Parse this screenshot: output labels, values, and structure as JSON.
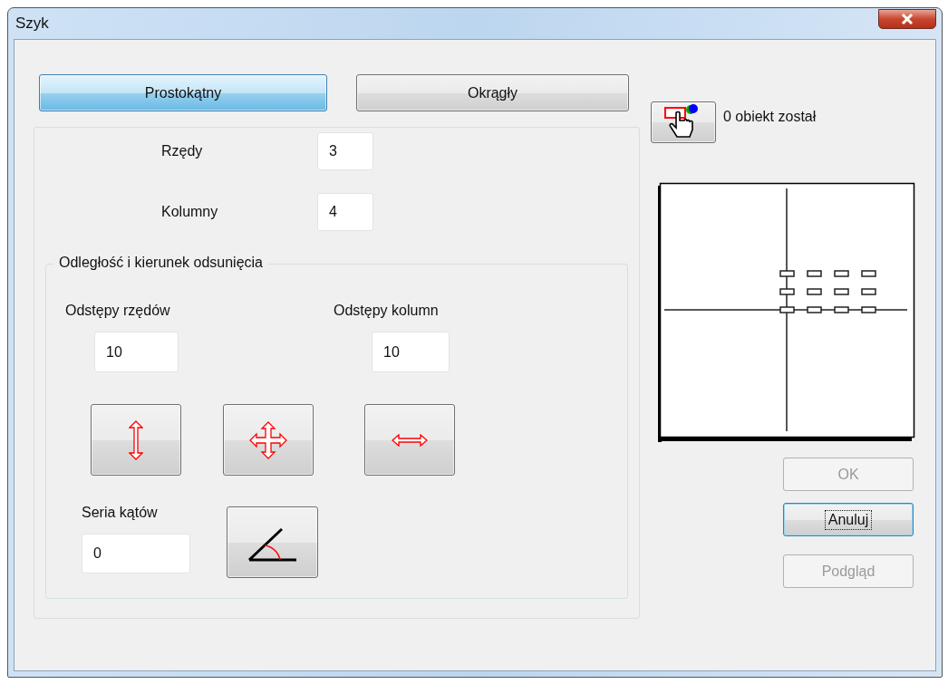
{
  "window": {
    "title": "Szyk"
  },
  "mode_tabs": [
    {
      "label": "Prostokątny",
      "selected": true
    },
    {
      "label": "Okrągły",
      "selected": false
    }
  ],
  "selection": {
    "status": "0 obiekt został"
  },
  "rows": {
    "label": "Rzędy",
    "value": "3"
  },
  "columns": {
    "label": "Kolumny",
    "value": "4"
  },
  "offset_group": {
    "title": "Odległość i kierunek odsunięcia",
    "row_spacing": {
      "label": "Odstępy rzędów",
      "value": "10"
    },
    "column_spacing": {
      "label": "Odstępy kolumn",
      "value": "10"
    },
    "angle": {
      "label": "Seria kątów",
      "value": "0"
    }
  },
  "buttons": [
    {
      "label": "OK",
      "disabled": true,
      "focused": false
    },
    {
      "label": "Anuluj",
      "disabled": false,
      "focused": true
    },
    {
      "label": "Podgląd",
      "disabled": true,
      "focused": false
    }
  ]
}
